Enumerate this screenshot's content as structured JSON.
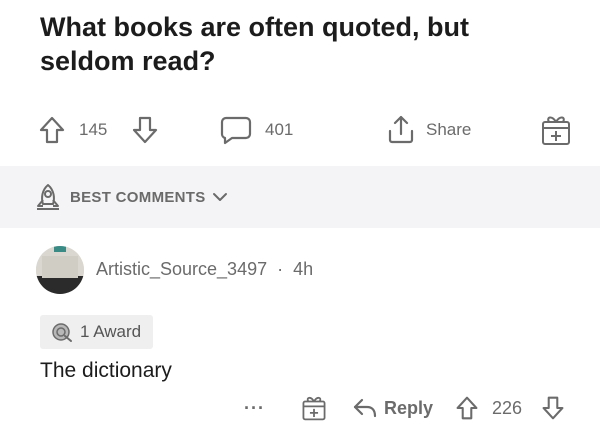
{
  "post": {
    "title": "What books are often quoted, but seldom read?",
    "upvotes": "145",
    "comments": "401",
    "share_label": "Share"
  },
  "sort": {
    "label": "BEST COMMENTS"
  },
  "comment": {
    "author": "Artistic_Source_3497",
    "separator": "·",
    "age": "4h",
    "award_label": "1 Award",
    "body": "The dictionary",
    "more": "···",
    "reply_label": "Reply",
    "votes": "226"
  },
  "icons": {
    "upvote": "arrow-up-outline-icon",
    "downvote": "arrow-down-outline-icon",
    "comments": "speech-bubble-icon",
    "share": "share-upload-icon",
    "award": "gift-box-icon",
    "sort": "rocket-icon",
    "chevron": "chevron-down-icon",
    "reply": "reply-arrow-icon",
    "more": "more-dots-icon",
    "award_badge": "silver-award-icon"
  },
  "colors": {
    "text_primary": "#1c1c1c",
    "text_secondary": "#6b6b6b",
    "sort_band_bg": "#f4f4f6",
    "award_pill_bg": "#efefef"
  }
}
